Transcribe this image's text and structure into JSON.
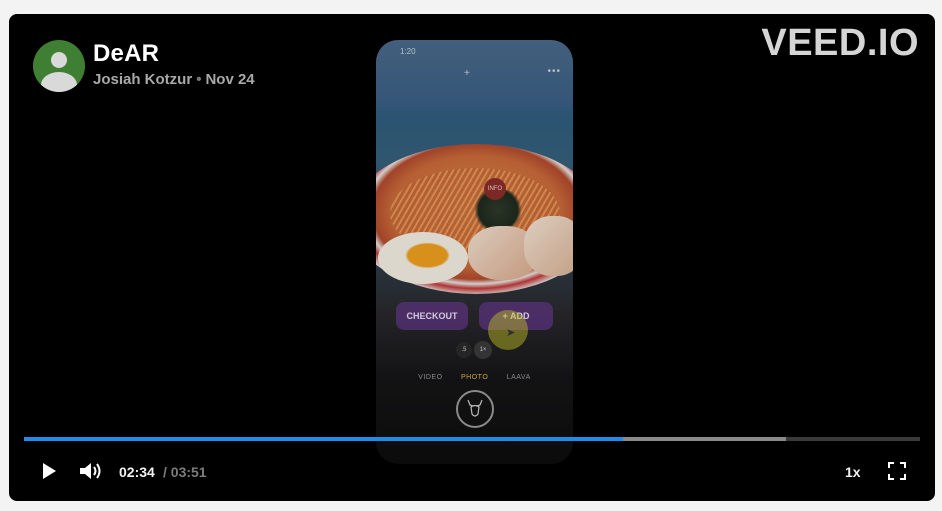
{
  "video": {
    "title": "DeAR",
    "author": "Josiah Kotzur",
    "separator": "•",
    "date": "Nov 24",
    "brand": "VEED.IO"
  },
  "frame": {
    "status_time": "1:20",
    "menu_dots": "•••",
    "add_icon": "+",
    "info_chip": "INFO",
    "checkout_label": "CHECKOUT",
    "add_label": "+ ADD",
    "zoom_half": ".5",
    "zoom_one": "1×",
    "modes": [
      "VIDEO",
      "PHOTO",
      "LAAVA"
    ],
    "active_mode": "PHOTO",
    "shutter_icon": "deer-icon"
  },
  "controls": {
    "current_time": "02:34",
    "total_time": "/ 03:51",
    "speed": "1x",
    "played_fraction": 0.668,
    "buffered_fraction": 0.851,
    "icons": [
      "play-icon",
      "volume-icon",
      "fullscreen-icon"
    ]
  },
  "colors": {
    "accent": "#1f8bea",
    "avatar": "#3f7f34",
    "background": "#000000"
  }
}
